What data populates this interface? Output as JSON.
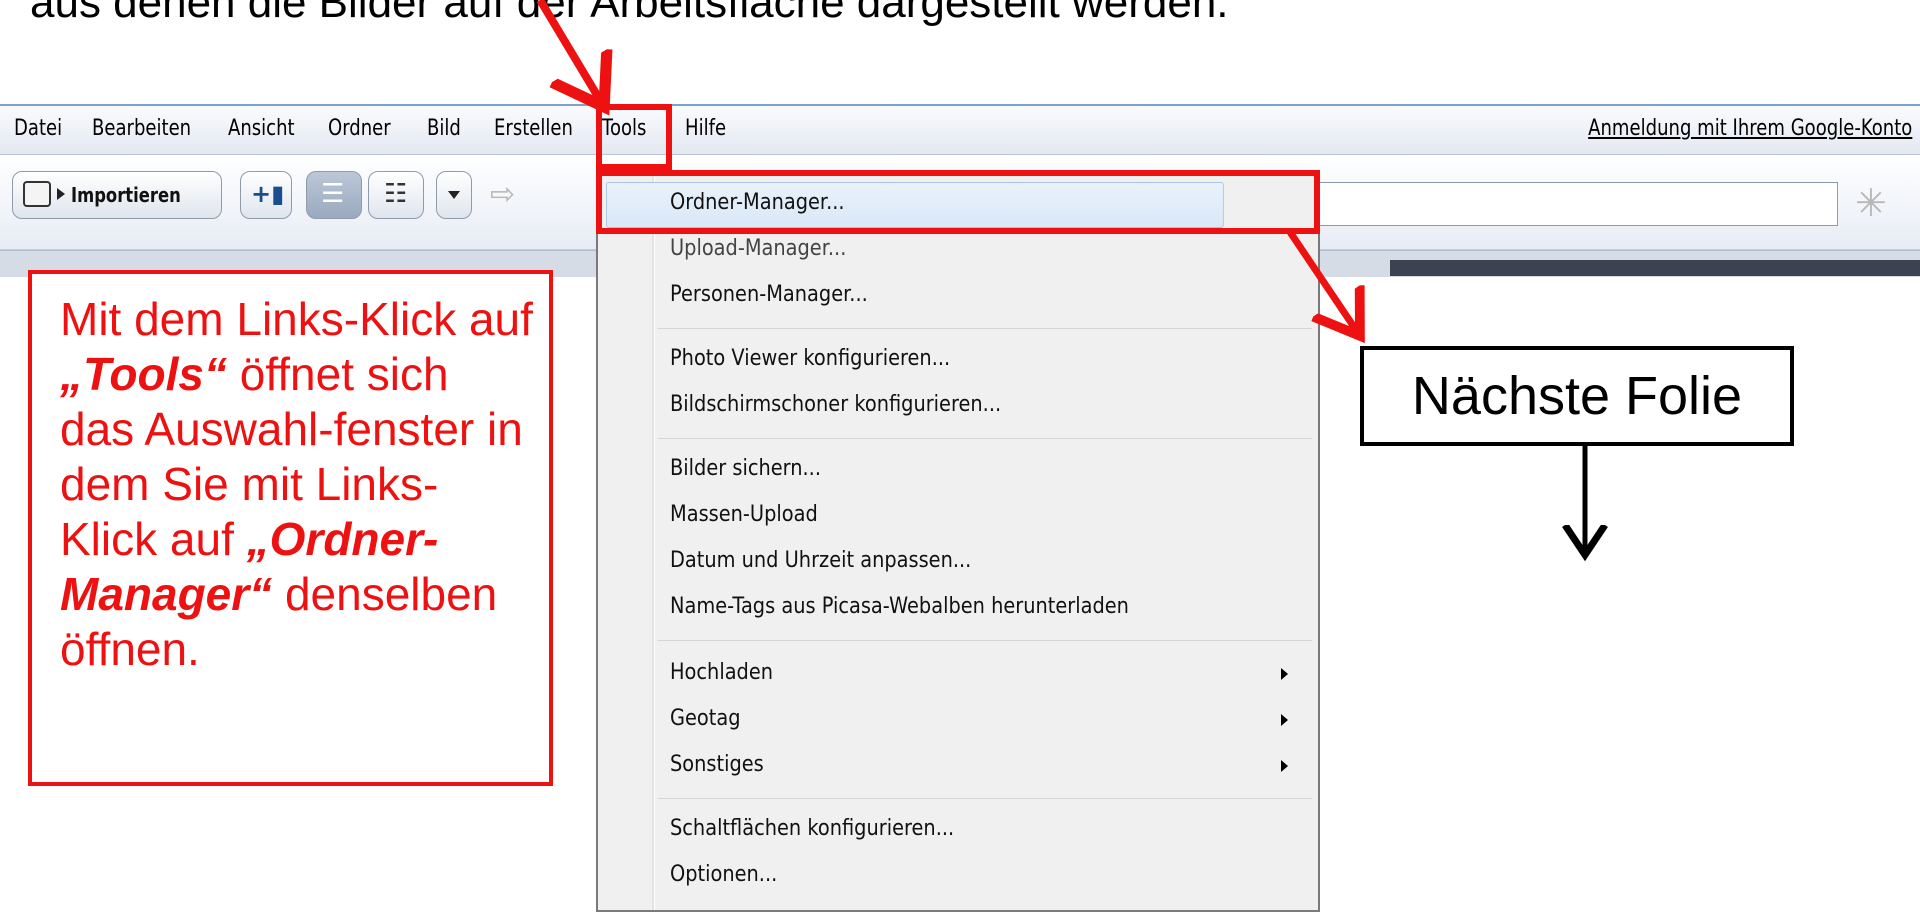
{
  "caption": "aus denen die Bilder auf der Arbeitsfläche dargestellt werden.",
  "menubar": {
    "items": [
      "Datei",
      "Bearbeiten",
      "Ansicht",
      "Ordner",
      "Bild",
      "Erstellen",
      "Tools",
      "Hilfe"
    ],
    "signin": "Anmeldung mit Ihrem Google-Konto"
  },
  "toolbar": {
    "import_label": "Importieren"
  },
  "dropdown": {
    "items": [
      "Ordner-Manager...",
      "Upload-Manager...",
      "Personen-Manager...",
      "Photo Viewer konfigurieren...",
      "Bildschirmschoner konfigurieren...",
      "Bilder sichern...",
      "Massen-Upload",
      "Datum und Uhrzeit anpassen...",
      "Name-Tags aus Picasa-Webalben herunterladen",
      "Hochladen",
      "Geotag",
      "Sonstiges",
      "Schaltflächen konfigurieren...",
      "Optionen..."
    ]
  },
  "note": {
    "part1": "Mit dem Links-Klick auf ",
    "tools": "„Tools“",
    "part2": " öffnet sich das Auswahl-fenster in dem Sie mit Links-Klick auf ",
    "manager": "„Ordner-Manager“",
    "part3": " denselben öffnen."
  },
  "next_label": "Nächste Folie",
  "colors": {
    "annotation_red": "#ee1111",
    "menu_bg": "#f0f0f0",
    "highlight": "#d9e7f7"
  }
}
